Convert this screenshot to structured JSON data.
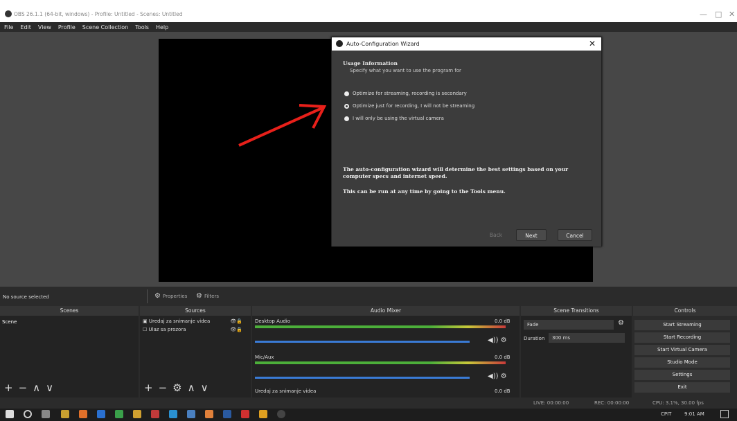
{
  "window": {
    "title": "OBS 26.1.1 (64-bit, windows) - Profile: Untitled - Scenes: Untitled"
  },
  "menu": [
    "File",
    "Edit",
    "View",
    "Profile",
    "Scene Collection",
    "Tools",
    "Help"
  ],
  "dialog": {
    "title": "Auto-Configuration Wizard",
    "heading": "Usage Information",
    "subheading": "Specify what you want to use the program for",
    "options": [
      "Optimize for streaming, recording is secondary",
      "Optimize just for recording, I will not be streaming",
      "I will only be using the virtual camera"
    ],
    "selected_index": 1,
    "info1": "The auto-configuration wizard will determine the best settings based on your computer specs and internet speed.",
    "info2": "This can be run at any time by going to the Tools menu.",
    "back": "Back",
    "next": "Next",
    "cancel": "Cancel"
  },
  "source_bar": {
    "no_source": "No source selected",
    "properties": "Properties",
    "filters": "Filters"
  },
  "docks": {
    "scenes": "Scenes",
    "sources": "Sources",
    "mixer": "Audio Mixer",
    "transitions": "Scene Transitions",
    "controls": "Controls"
  },
  "scenes_list": [
    "Scene"
  ],
  "sources_list": [
    "Uredaj za snimanje videa",
    "Ulaz sa prozora"
  ],
  "mixer": [
    {
      "name": "Desktop Audio",
      "db": "0.0 dB"
    },
    {
      "name": "Mic/Aux",
      "db": "0.0 dB"
    },
    {
      "name": "Uredaj za snimanje videa",
      "db": "0.0 dB"
    }
  ],
  "transitions": {
    "type": "Fade",
    "duration_label": "Duration",
    "duration": "300 ms"
  },
  "controls": [
    "Start Streaming",
    "Start Recording",
    "Start Virtual Camera",
    "Studio Mode",
    "Settings",
    "Exit"
  ],
  "status": {
    "live": "LIVE: 00:00:00",
    "rec": "REC: 00:00:00",
    "cpu": "CPU: 3.1%, 30.00 fps"
  },
  "taskbar": {
    "time": "9:01 AM",
    "lang": "CPIT"
  },
  "colors": {
    "accent_arrow": "#e8201a",
    "meter_green": "#4caf3a",
    "slider_blue": "#3a7bd5"
  }
}
